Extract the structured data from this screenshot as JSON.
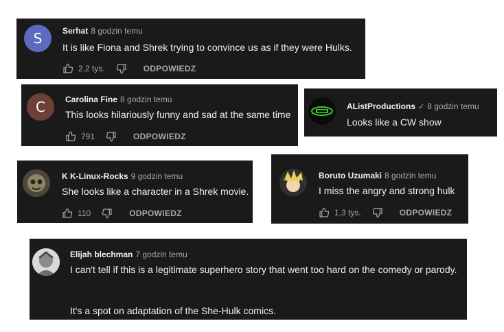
{
  "reply_label": "ODPOWIEDZ",
  "icons": {
    "like": "thumbs-up-icon",
    "dislike": "thumbs-down-icon",
    "verified": "check-icon"
  },
  "comments": [
    {
      "author": "Serhat",
      "time": "8 godzin temu",
      "text": "It is like Fiona and Shrek trying to convince us as if they were Hulks.",
      "likes": "2,2 tys.",
      "avatar_letter": "S",
      "avatar_color": "#5c6bc0"
    },
    {
      "author": "Carolina Fine",
      "time": "8 godzin temu",
      "text": "This looks hilariously funny and sad at the same time",
      "likes": "791",
      "avatar_letter": "C",
      "avatar_color": "#6d4036"
    },
    {
      "author": "AListProductions",
      "verified": "✓",
      "time": "8 godzin temu",
      "text": "Looks like a CW show"
    },
    {
      "author": "K K-Linux-Rocks",
      "time": "9 godzin temu",
      "text": "She looks like a character in a Shrek movie.",
      "likes": "110"
    },
    {
      "author": "Boruto Uzumaki",
      "time": "8 godzin temu",
      "text": "I miss the angry and strong hulk",
      "likes": "1,3 tys."
    },
    {
      "author": "Elijah blechman",
      "time": "7 godzin temu",
      "text": "I can't tell if this is a legitimate superhero story that went too hard on the comedy or parody.",
      "text2": "It's a spot on adaptation of the She-Hulk comics."
    }
  ]
}
